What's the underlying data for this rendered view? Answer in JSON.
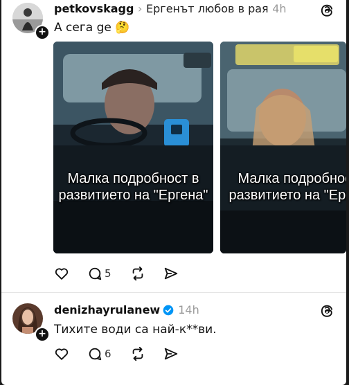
{
  "post1": {
    "username": "petkovskagg",
    "separator": "›",
    "topic": "Ергенът любов в рая",
    "time": "4h",
    "text": "А сега ge 🤔",
    "media": [
      {
        "caption_line1": "Малка подробност в",
        "caption_line2": "развитието на \"Ергена\""
      },
      {
        "caption_line1": "Малка подробност в",
        "caption_line2": "развитието на \"Ергена\""
      }
    ],
    "replies": "5"
  },
  "post2": {
    "username": "denizhayrulanew",
    "time": "14h",
    "text": "Тихите води са най-к**ви.",
    "replies": "6"
  },
  "colors": {
    "verified": "#0095f6",
    "text": "#111111",
    "muted": "#999999"
  }
}
